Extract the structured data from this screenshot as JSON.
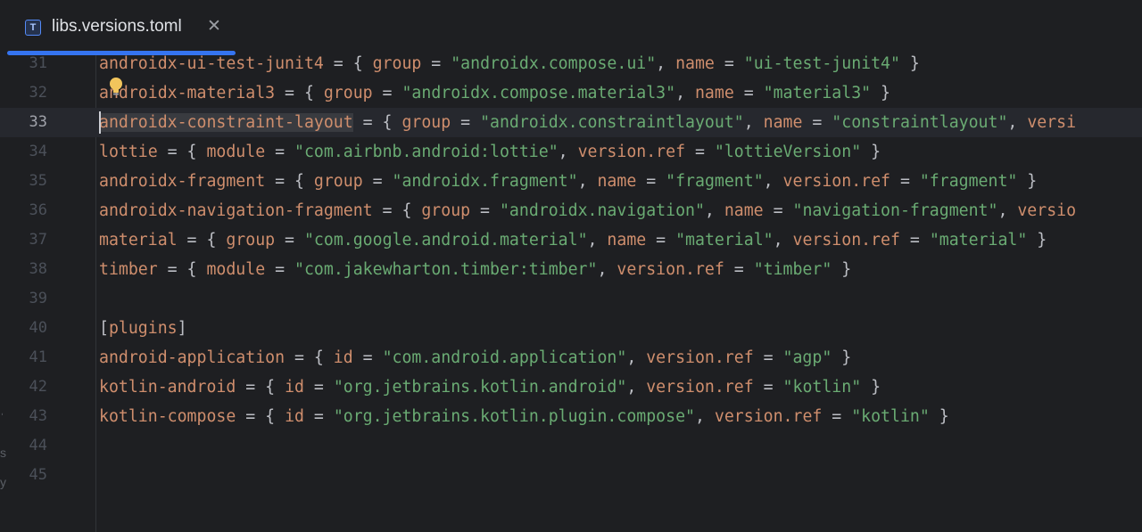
{
  "tab": {
    "icon_letter": "T",
    "title": "libs.versions.toml",
    "close_glyph": "✕"
  },
  "colors": {
    "background": "#1e1f22",
    "current_line": "#26282e",
    "key": "#cf8e6d",
    "string": "#6aab73",
    "punctuation": "#bcbec4",
    "accent": "#3574f0"
  },
  "editor": {
    "current_line_number": "33",
    "lines": [
      {
        "n": "31",
        "tokens": [
          [
            "k",
            "androidx-ui-test-junit4"
          ],
          [
            "p",
            " = { "
          ],
          [
            "k",
            "group"
          ],
          [
            "p",
            " = "
          ],
          [
            "s",
            "\"androidx.compose.ui\""
          ],
          [
            "p",
            ", "
          ],
          [
            "k",
            "name"
          ],
          [
            "p",
            " = "
          ],
          [
            "s",
            "\"ui-test-junit4\""
          ],
          [
            "p",
            " }"
          ]
        ]
      },
      {
        "n": "32",
        "tokens": [
          [
            "k",
            "androidx-material3"
          ],
          [
            "p",
            " = { "
          ],
          [
            "k",
            "group"
          ],
          [
            "p",
            " = "
          ],
          [
            "s",
            "\"androidx.compose.material3\""
          ],
          [
            "p",
            ", "
          ],
          [
            "k",
            "name"
          ],
          [
            "p",
            " = "
          ],
          [
            "s",
            "\"material3\""
          ],
          [
            "p",
            " }"
          ]
        ]
      },
      {
        "n": "33",
        "tokens": [
          [
            "kh",
            "androidx-constraint-layout"
          ],
          [
            "p",
            " = { "
          ],
          [
            "k",
            "group"
          ],
          [
            "p",
            " = "
          ],
          [
            "s",
            "\"androidx.constraintlayout\""
          ],
          [
            "p",
            ", "
          ],
          [
            "k",
            "name"
          ],
          [
            "p",
            " = "
          ],
          [
            "s",
            "\"constraintlayout\""
          ],
          [
            "p",
            ", "
          ],
          [
            "k",
            "versi"
          ]
        ]
      },
      {
        "n": "34",
        "tokens": [
          [
            "k",
            "lottie"
          ],
          [
            "p",
            " = { "
          ],
          [
            "k",
            "module"
          ],
          [
            "p",
            " = "
          ],
          [
            "s",
            "\"com.airbnb.android:lottie\""
          ],
          [
            "p",
            ", "
          ],
          [
            "k",
            "version.ref"
          ],
          [
            "p",
            " = "
          ],
          [
            "s",
            "\"lottieVersion\""
          ],
          [
            "p",
            " }"
          ]
        ]
      },
      {
        "n": "35",
        "tokens": [
          [
            "k",
            "androidx-fragment"
          ],
          [
            "p",
            " = { "
          ],
          [
            "k",
            "group"
          ],
          [
            "p",
            " = "
          ],
          [
            "s",
            "\"androidx.fragment\""
          ],
          [
            "p",
            ", "
          ],
          [
            "k",
            "name"
          ],
          [
            "p",
            " = "
          ],
          [
            "s",
            "\"fragment\""
          ],
          [
            "p",
            ", "
          ],
          [
            "k",
            "version.ref"
          ],
          [
            "p",
            " = "
          ],
          [
            "s",
            "\"fragment\""
          ],
          [
            "p",
            " }"
          ]
        ]
      },
      {
        "n": "36",
        "tokens": [
          [
            "k",
            "androidx-navigation-fragment"
          ],
          [
            "p",
            " = { "
          ],
          [
            "k",
            "group"
          ],
          [
            "p",
            " = "
          ],
          [
            "s",
            "\"androidx.navigation\""
          ],
          [
            "p",
            ", "
          ],
          [
            "k",
            "name"
          ],
          [
            "p",
            " = "
          ],
          [
            "s",
            "\"navigation-fragment\""
          ],
          [
            "p",
            ", "
          ],
          [
            "k",
            "versio"
          ]
        ]
      },
      {
        "n": "37",
        "tokens": [
          [
            "k",
            "material"
          ],
          [
            "p",
            " = { "
          ],
          [
            "k",
            "group"
          ],
          [
            "p",
            " = "
          ],
          [
            "s",
            "\"com.google.android.material\""
          ],
          [
            "p",
            ", "
          ],
          [
            "k",
            "name"
          ],
          [
            "p",
            " = "
          ],
          [
            "s",
            "\"material\""
          ],
          [
            "p",
            ", "
          ],
          [
            "k",
            "version.ref"
          ],
          [
            "p",
            " = "
          ],
          [
            "s",
            "\"material\""
          ],
          [
            "p",
            " }"
          ]
        ]
      },
      {
        "n": "38",
        "tokens": [
          [
            "k",
            "timber"
          ],
          [
            "p",
            " = { "
          ],
          [
            "k",
            "module"
          ],
          [
            "p",
            " = "
          ],
          [
            "s",
            "\"com.jakewharton.timber:timber\""
          ],
          [
            "p",
            ", "
          ],
          [
            "k",
            "version.ref"
          ],
          [
            "p",
            " = "
          ],
          [
            "s",
            "\"timber\""
          ],
          [
            "p",
            " }"
          ]
        ]
      },
      {
        "n": "39",
        "tokens": []
      },
      {
        "n": "40",
        "tokens": [
          [
            "p",
            "["
          ],
          [
            "k",
            "plugins"
          ],
          [
            "p",
            "]"
          ]
        ]
      },
      {
        "n": "41",
        "tokens": [
          [
            "k",
            "android-application"
          ],
          [
            "p",
            " = { "
          ],
          [
            "k",
            "id"
          ],
          [
            "p",
            " = "
          ],
          [
            "s",
            "\"com.android.application\""
          ],
          [
            "p",
            ", "
          ],
          [
            "k",
            "version.ref"
          ],
          [
            "p",
            " = "
          ],
          [
            "s",
            "\"agp\""
          ],
          [
            "p",
            " }"
          ]
        ]
      },
      {
        "n": "42",
        "tokens": [
          [
            "k",
            "kotlin-android"
          ],
          [
            "p",
            " = { "
          ],
          [
            "k",
            "id"
          ],
          [
            "p",
            " = "
          ],
          [
            "s",
            "\"org.jetbrains.kotlin.android\""
          ],
          [
            "p",
            ", "
          ],
          [
            "k",
            "version.ref"
          ],
          [
            "p",
            " = "
          ],
          [
            "s",
            "\"kotlin\""
          ],
          [
            "p",
            " }"
          ]
        ]
      },
      {
        "n": "43",
        "tokens": [
          [
            "k",
            "kotlin-compose"
          ],
          [
            "p",
            " = { "
          ],
          [
            "k",
            "id"
          ],
          [
            "p",
            " = "
          ],
          [
            "s",
            "\"org.jetbrains.kotlin.plugin.compose\""
          ],
          [
            "p",
            ", "
          ],
          [
            "k",
            "version.ref"
          ],
          [
            "p",
            " = "
          ],
          [
            "s",
            "\"kotlin\""
          ],
          [
            "p",
            " }"
          ]
        ]
      },
      {
        "n": "44",
        "tokens": []
      },
      {
        "n": "45",
        "tokens": []
      }
    ]
  }
}
